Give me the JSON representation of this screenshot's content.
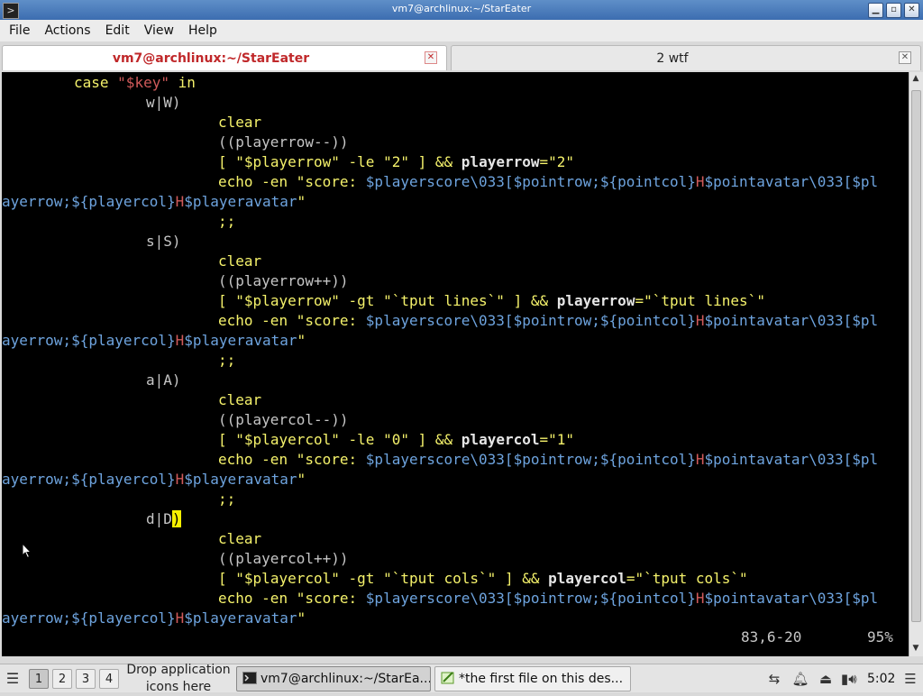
{
  "window": {
    "title": "vm7@archlinux:~/StarEater",
    "app_icon": "terminal-icon",
    "buttons": [
      "minimize-icon",
      "maximize-icon",
      "close-icon"
    ]
  },
  "menu": [
    "File",
    "Actions",
    "Edit",
    "View",
    "Help"
  ],
  "tabs": [
    {
      "label": "vm7@archlinux:~/StarEater",
      "active": true
    },
    {
      "label": "2 wtf",
      "active": false
    }
  ],
  "colors": {
    "keyword": "#f5f26b",
    "variable": "#6ea4df",
    "plain": "#c6c6c6",
    "bold_assign": "#e6e6e6",
    "cursor": "#f5f000",
    "active_tab_text": "#c0282a"
  },
  "code": {
    "l0": {
      "kw": "case",
      "str": "\"$key\"",
      "kw2": "in"
    },
    "l1": "w|W)",
    "l2": "clear",
    "l3": "((playerrow--))",
    "l4": {
      "a": "[",
      "s1": "\"$playerrow\"",
      "op": "-le",
      "s2": "\"2\"",
      "b": "]",
      "and": "&&",
      "var": "playerrow",
      "eq": "=\"2\""
    },
    "echo": {
      "cmd": "echo",
      "flag": "-en",
      "q": "\"score:",
      "v1": "$playerscore\\033[",
      "v2": "$pointrow;${pointcol}",
      "h": "H",
      "v3": "$pointavatar\\033[",
      "v4": "$pl"
    },
    "wrap": {
      "v1": "ayerrow;${playercol}",
      "h": "H",
      "v2": "$playeravatar",
      "q": "\""
    },
    "semi": ";;",
    "l8": "s|S)",
    "l10": "((playerrow++))",
    "l11": {
      "a": "[",
      "s1": "\"$playerrow\"",
      "op": "-gt",
      "s2": "\"`tput lines`\"",
      "b": "]",
      "and": "&&",
      "var": "playerrow",
      "eq": "=\"`tput lines`\""
    },
    "l15": "a|A)",
    "l17": "((playercol--))",
    "l18": {
      "a": "[",
      "s1": "\"$playercol\"",
      "op": "-le",
      "s2": "\"0\"",
      "b": "]",
      "and": "&&",
      "var": "playercol",
      "eq": "=\"1\""
    },
    "l22": {
      "pre": "d|D",
      "cur": ")"
    },
    "l24": "((playercol++))",
    "l25": {
      "a": "[",
      "s1": "\"$playercol\"",
      "op": "-gt",
      "s2": "\"`tput cols`\"",
      "b": "]",
      "and": "&&",
      "var": "playercol",
      "eq": "=\"`tput cols`\""
    }
  },
  "status": {
    "position": "83,6-20",
    "percent": "95%"
  },
  "taskbar": {
    "start_icon": "menu-icon",
    "workspaces": [
      "1",
      "2",
      "3",
      "4"
    ],
    "active_workspace": "1",
    "drop_text_1": "Drop application",
    "drop_text_2": "icons here",
    "tasks": [
      {
        "label": "vm7@archlinux:~/StarEa...",
        "icon": "terminal-icon"
      },
      {
        "label": "*the first file on this des...",
        "icon": "text-editor-icon"
      }
    ],
    "tray_icons": [
      "network-icon",
      "notification-icon",
      "usb-icon",
      "battery-icon",
      "volume-icon"
    ],
    "clock": "5:02",
    "end_icon": "menu-icon"
  }
}
